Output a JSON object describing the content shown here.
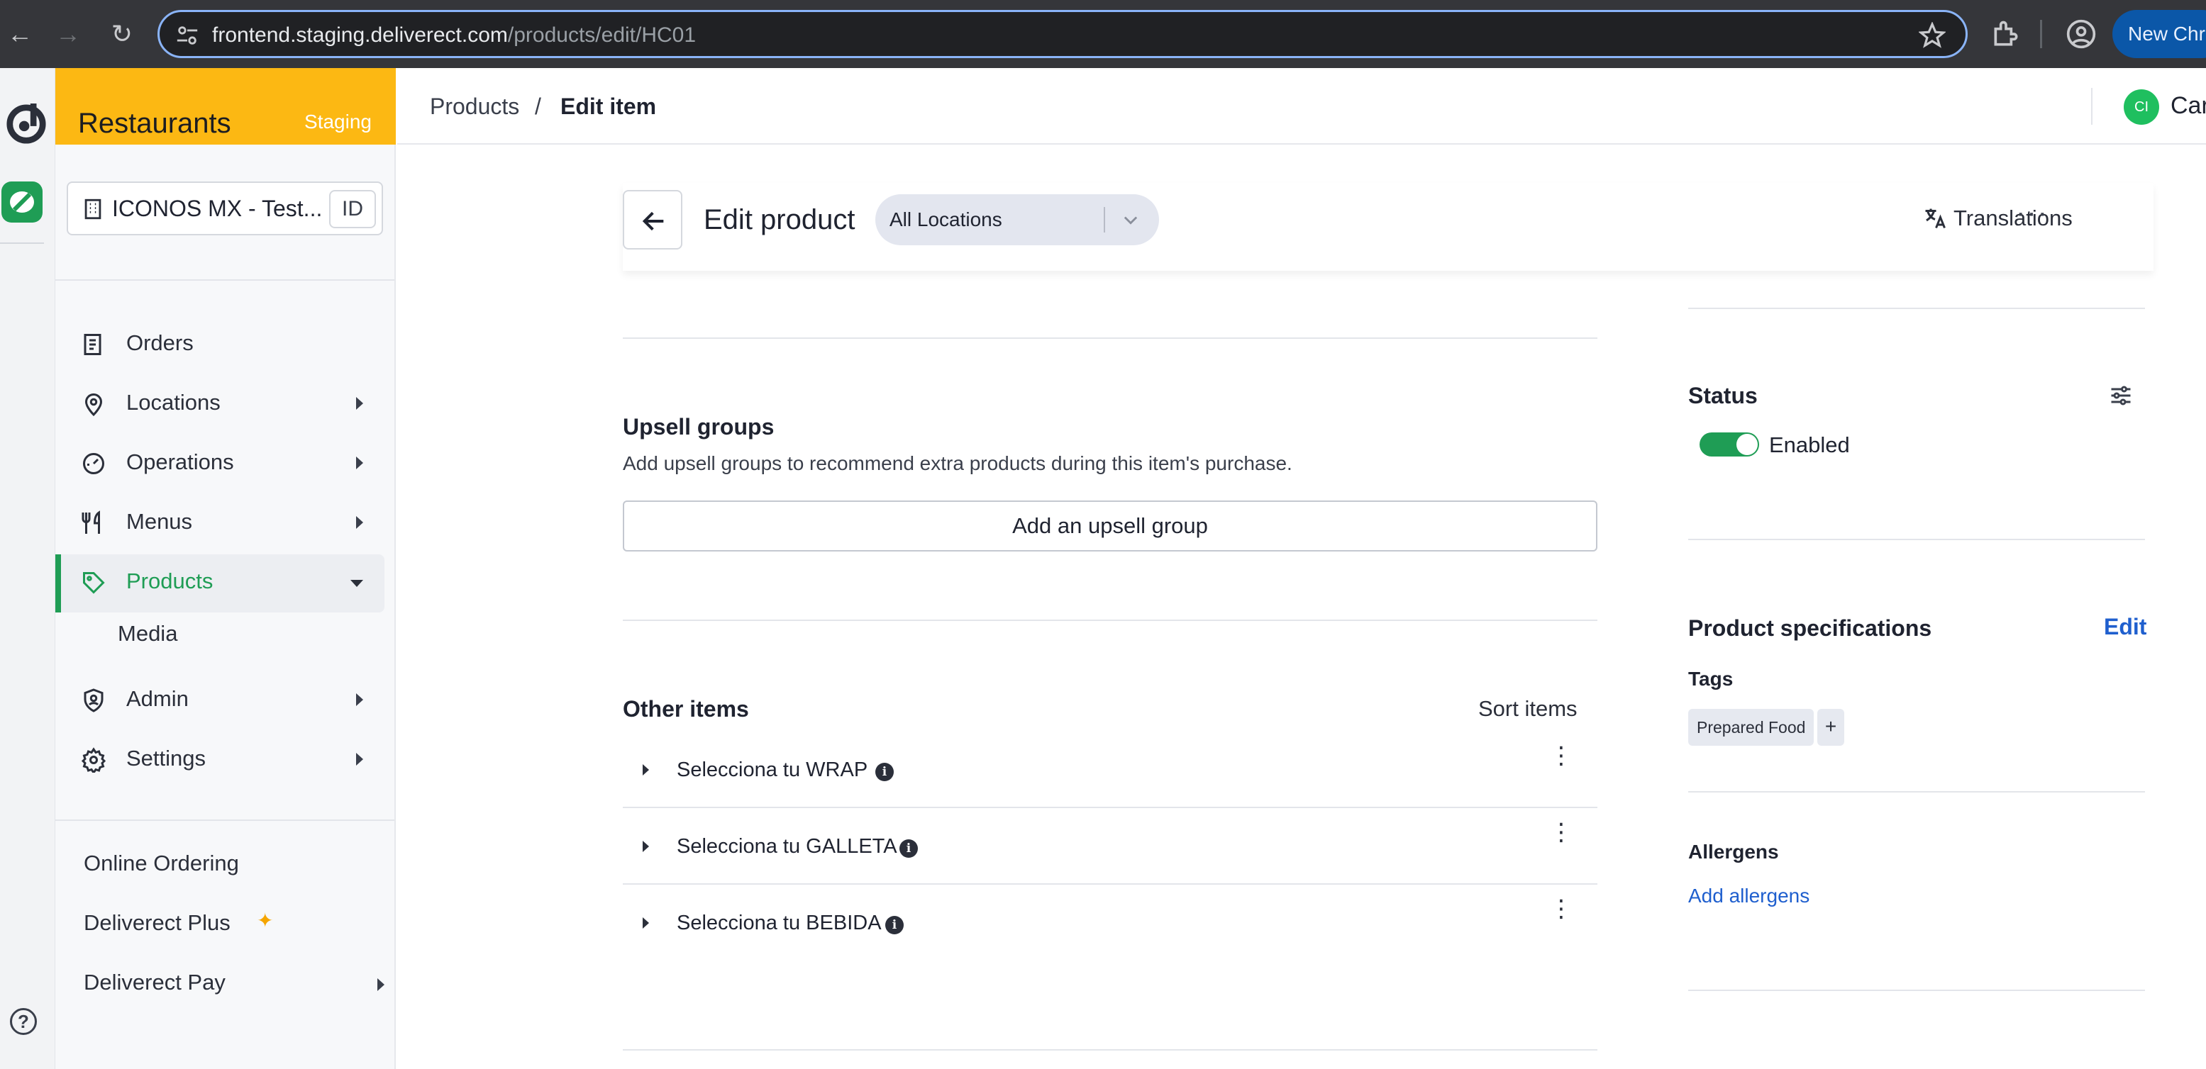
{
  "browser": {
    "url_host": "frontend.staging.deliverect.com",
    "url_path": "/products/edit/HC01",
    "new_chrome_label": "New Chro"
  },
  "sidebar": {
    "brand_title": "Restaurants",
    "environment": "Staging",
    "account_name": "ICONOS MX - Test...",
    "account_id_badge": "ID",
    "nav": [
      {
        "label": "Orders",
        "icon": "receipt-icon"
      },
      {
        "label": "Locations",
        "icon": "location-pin-icon"
      },
      {
        "label": "Operations",
        "icon": "gauge-icon"
      },
      {
        "label": "Menus",
        "icon": "cutlery-icon"
      },
      {
        "label": "Products",
        "icon": "tag-icon"
      },
      {
        "label": "Media"
      },
      {
        "label": "Admin",
        "icon": "shield-user-icon"
      },
      {
        "label": "Settings",
        "icon": "gear-icon"
      }
    ],
    "extra": [
      {
        "label": "Online Ordering"
      },
      {
        "label": "Deliverect Plus"
      },
      {
        "label": "Deliverect Pay"
      }
    ],
    "accent_color": "#1f9d55",
    "brand_color": "#fcb813"
  },
  "topbar": {
    "breadcrumb_root": "Products",
    "breadcrumb_sep": "/",
    "breadcrumb_current": "Edit item",
    "avatar_initials": "CI",
    "user_name": "Car"
  },
  "header": {
    "title": "Edit product",
    "location_value": "All Locations",
    "translations_label": "Translations",
    "more_label": "···"
  },
  "upsell": {
    "title": "Upsell groups",
    "description": "Add upsell groups to recommend extra products during this item's purchase.",
    "button_label": "Add an upsell group"
  },
  "other_items": {
    "title": "Other items",
    "sort_label": "Sort items",
    "rows": [
      {
        "label": "Selecciona tu WRAP"
      },
      {
        "label": "Selecciona tu GALLETA"
      },
      {
        "label": "Selecciona tu BEBIDA"
      }
    ]
  },
  "status": {
    "title": "Status",
    "toggle_label": "Enabled",
    "enabled": true
  },
  "specs": {
    "title": "Product specifications",
    "edit_label": "Edit",
    "tags_label": "Tags",
    "tags": [
      "Prepared Food"
    ],
    "add_tag_label": "+",
    "allergens_label": "Allergens",
    "add_allergens_label": "Add allergens"
  }
}
